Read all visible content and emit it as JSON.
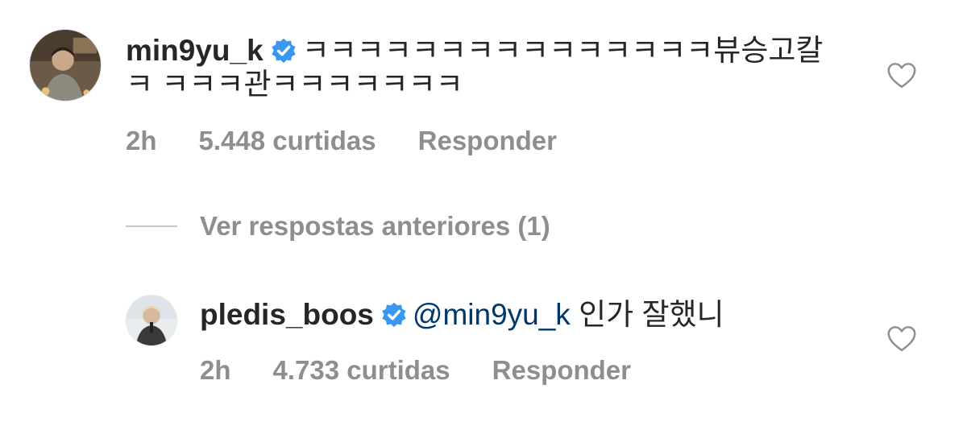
{
  "comments": [
    {
      "username": "min9yu_k",
      "text": "ㅋㅋㅋㅋㅋㅋㅋㅋㅋㅋㅋㅋㅋㅋㅋ뷰승고칼ㅋ ㅋㅋㅋ관ㅋㅋㅋㅋㅋㅋㅋ",
      "time": "2h",
      "likes": "5.448 curtidas",
      "reply": "Responder"
    },
    {
      "username": "pledis_boos",
      "mention": "@min9yu_k",
      "text": " 인가 잘했니",
      "time": "2h",
      "likes": "4.733 curtidas",
      "reply": "Responder"
    }
  ],
  "view_replies": "Ver respostas anteriores (1)",
  "colors": {
    "text": "#262626",
    "secondary": "#8e8e8e",
    "mention": "#00376b",
    "verified": "#3897f0"
  },
  "icons": {
    "verified": "verified-badge-icon",
    "like": "heart-outline-icon"
  }
}
